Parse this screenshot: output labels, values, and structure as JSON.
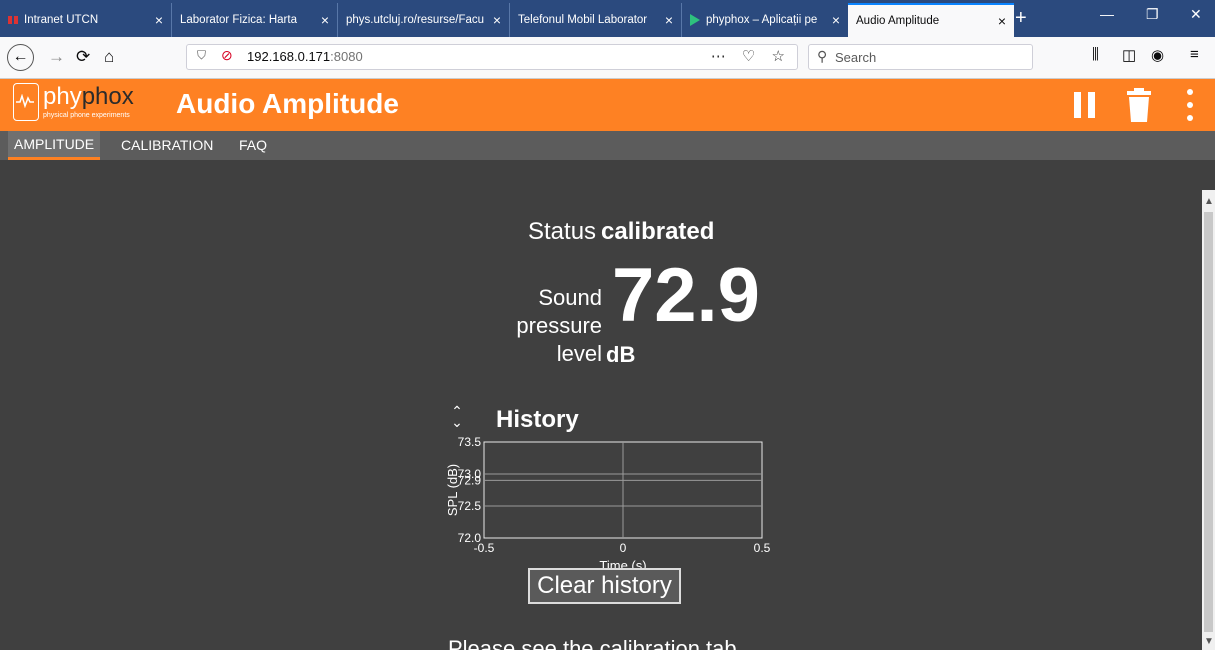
{
  "browser": {
    "tabs": [
      {
        "title": "Intranet UTCN",
        "close": "×"
      },
      {
        "title": "Laborator Fizica: Harta",
        "close": "×"
      },
      {
        "title": "phys.utcluj.ro/resurse/Facu",
        "close": "×"
      },
      {
        "title": "Telefonul Mobil Laborator",
        "close": "×"
      },
      {
        "title": "phyphox – Aplicații pe",
        "close": "×"
      },
      {
        "title": "Audio Amplitude",
        "close": "×"
      }
    ],
    "new_tab": "+",
    "window_controls": {
      "minimize": "—",
      "restore": "❐",
      "close": "✕"
    },
    "url_host": "192.168.0.171",
    "url_port": ":8080",
    "url_actions": "⋯ ♡ ☆",
    "search_placeholder": "Search",
    "toolbar_icons": [
      "library-icon",
      "sidebar-icon",
      "account-icon",
      "menu-icon"
    ]
  },
  "app": {
    "brand_part1": "phy",
    "brand_part2": "phox",
    "tagline": "physical phone experiments",
    "title": "Audio Amplitude",
    "accent": "#fe8123",
    "tabs": [
      {
        "label": "AMPLITUDE",
        "active": true
      },
      {
        "label": "CALIBRATION",
        "active": false
      },
      {
        "label": "FAQ",
        "active": false
      }
    ]
  },
  "main": {
    "status_label": "Status",
    "status_value": "calibrated",
    "spl_label_lines": [
      "Sound",
      "pressure",
      "level"
    ],
    "spl_value": "72.9",
    "spl_unit": "dB",
    "history_title": "History",
    "clear_button": "Clear history",
    "note": "Please see the calibration tab"
  },
  "chart_data": {
    "type": "line",
    "xlabel": "Time (s)",
    "ylabel": "SPL (dB)",
    "xlim": [
      -0.5,
      0.5
    ],
    "ylim": [
      72.0,
      73.5
    ],
    "x_ticks": [
      "-0.5",
      "0",
      "0.5"
    ],
    "y_ticks": [
      "72.0",
      "72.5",
      "72.9",
      "73.0",
      "73.5"
    ],
    "grid": true,
    "series": [
      {
        "x": [],
        "y": []
      }
    ]
  }
}
